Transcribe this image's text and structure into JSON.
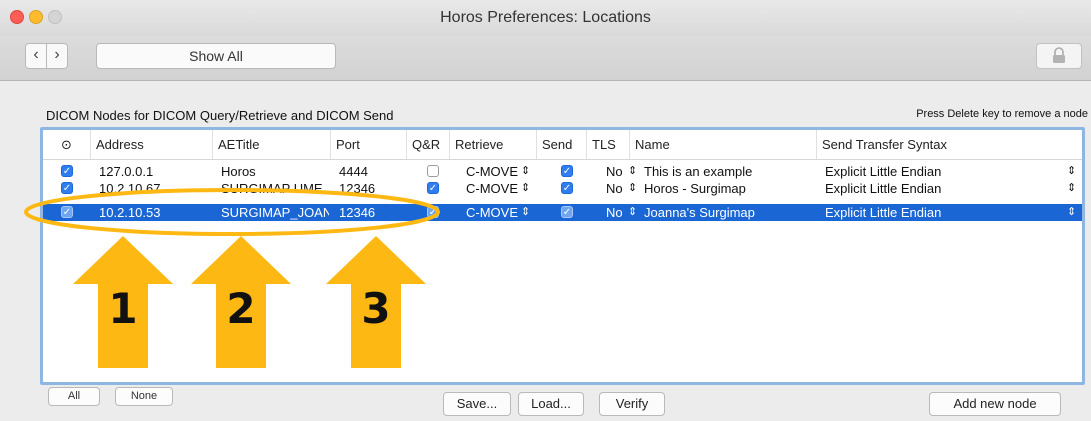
{
  "window": {
    "title": "Horos Preferences: Locations"
  },
  "toolbar": {
    "back_icon": "chevron-left",
    "forward_icon": "chevron-right",
    "show_all_label": "Show All",
    "lock_icon": "lock"
  },
  "section": {
    "label": "DICOM Nodes for DICOM Query/Retrieve and DICOM Send",
    "hint": "Press Delete key to remove a node"
  },
  "table": {
    "columns": [
      "⊙",
      "Address",
      "AETitle",
      "Port",
      "Q&R",
      "Retrieve",
      "Send",
      "TLS",
      "Name",
      "Send Transfer Syntax"
    ],
    "rows": [
      {
        "enabled": true,
        "address": "127.0.0.1",
        "aetitle": "Horos",
        "port": "4444",
        "qr": false,
        "retrieve": "C-MOVE",
        "send": true,
        "tls": "No",
        "name": "This is an example",
        "syntax": "Explicit Little Endian",
        "selected": false
      },
      {
        "enabled": true,
        "address": "10.2.10.67",
        "aetitle": "SURGIMAP UME",
        "port": "12346",
        "qr": true,
        "retrieve": "C-MOVE",
        "send": true,
        "tls": "No",
        "name": "Horos - Surgimap",
        "syntax": "Explicit Little Endian",
        "selected": false
      },
      {
        "enabled": true,
        "address": "10.2.10.53",
        "aetitle": "SURGIMAP_JOAN",
        "port": "12346",
        "qr": true,
        "retrieve": "C-MOVE",
        "send": true,
        "tls": "No",
        "name": "Joanna's Surgimap",
        "syntax": "Explicit Little Endian",
        "selected": true
      }
    ]
  },
  "buttons": {
    "all": "All",
    "none": "None",
    "save": "Save...",
    "load": "Load...",
    "verify": "Verify",
    "add_node": "Add new node"
  },
  "annotations": {
    "arrow1": "1",
    "arrow2": "2",
    "arrow3": "3"
  },
  "colors": {
    "selection": "#1a66d4",
    "annotation": "#fdb813",
    "checkbox": "#2f7ef0"
  }
}
